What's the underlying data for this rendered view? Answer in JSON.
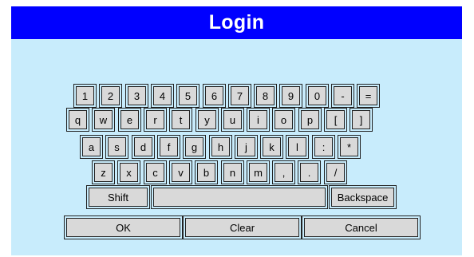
{
  "window": {
    "title": "Login"
  },
  "keyboard": {
    "row1": [
      "1",
      "2",
      "3",
      "4",
      "5",
      "6",
      "7",
      "8",
      "9",
      "0",
      "-",
      "="
    ],
    "row2": [
      "q",
      "w",
      "e",
      "r",
      "t",
      "y",
      "u",
      "i",
      "o",
      "p",
      "[",
      "]"
    ],
    "row3": [
      "a",
      "s",
      "d",
      "f",
      "g",
      "h",
      "j",
      "k",
      "l",
      ":",
      "*"
    ],
    "row4": [
      "z",
      "x",
      "c",
      "v",
      "b",
      "n",
      "m",
      ",",
      ".",
      "/"
    ],
    "shift": "Shift",
    "backspace": "Backspace",
    "space": ""
  },
  "actions": {
    "ok": "OK",
    "clear": "Clear",
    "cancel": "Cancel"
  }
}
